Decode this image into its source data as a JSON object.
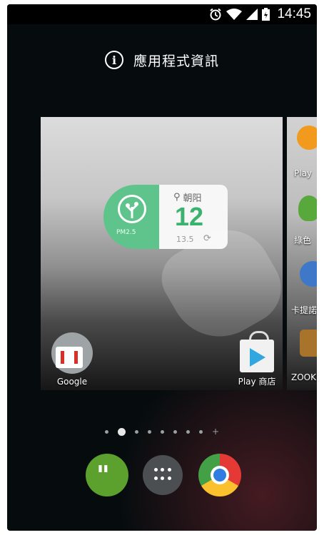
{
  "status_bar": {
    "time": "14:45",
    "icons": [
      "alarm-icon",
      "wifi-icon",
      "signal-icon",
      "battery-icon"
    ]
  },
  "header": {
    "info_icon": "info-icon",
    "label": "應用程式資訊"
  },
  "widget": {
    "pm_label": "PM2.5",
    "location": "朝阳",
    "aqi": "12",
    "pm_value": "13.5"
  },
  "apps": {
    "google_label": "Google",
    "play_store_label": "Play 商店"
  },
  "next_page_apps": [
    {
      "label": "Play",
      "icon": "play-music-icon"
    },
    {
      "label": "綠色",
      "icon": "leaf-icon"
    },
    {
      "label": "卡提諾",
      "icon": "app-icon"
    },
    {
      "label": "ZOOKE",
      "icon": "game-icon"
    }
  ],
  "page_indicator": {
    "count": 8,
    "active_index": 1
  },
  "dock": {
    "apps": [
      "hangouts-icon",
      "all-apps-icon",
      "chrome-icon"
    ]
  },
  "colors": {
    "widget_green": "#5fc38c",
    "aqi_green": "#3bb36f",
    "background": "#060c0e"
  }
}
